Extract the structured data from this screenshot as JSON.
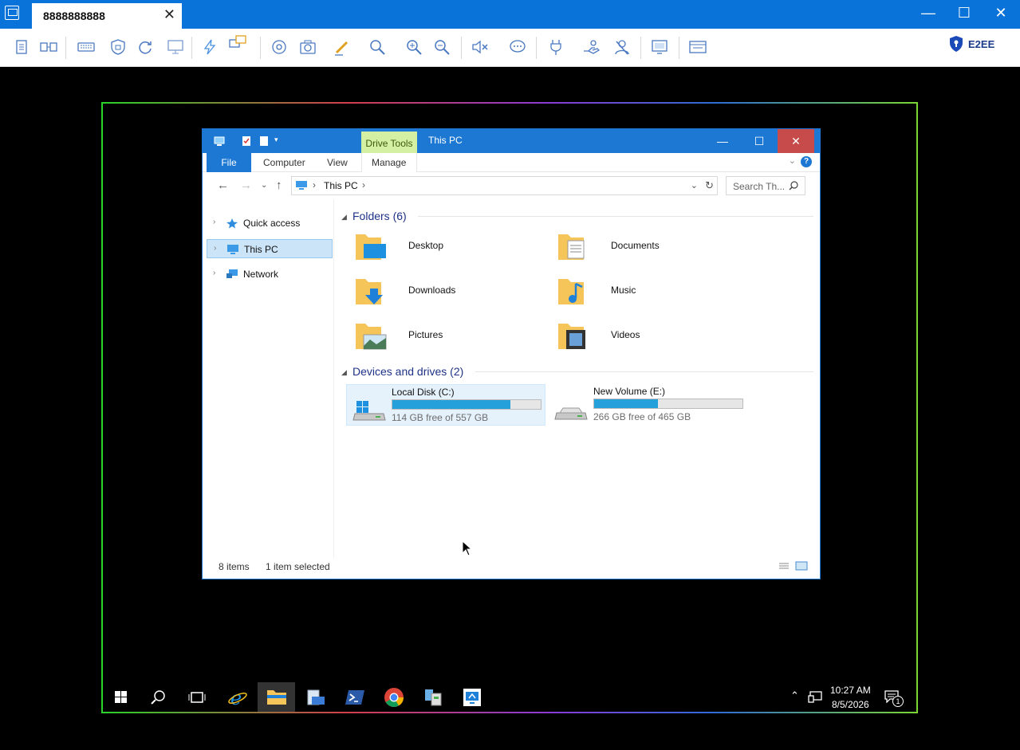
{
  "client": {
    "tab_title": "8888888888",
    "security_label": "E2EE"
  },
  "explorer": {
    "contextual_tab": "Drive Tools",
    "window_title": "This PC",
    "ribbon_tabs": [
      "File",
      "Computer",
      "View",
      "Manage"
    ],
    "address_path": "This PC",
    "search_placeholder": "Search Th...",
    "nav_items": [
      {
        "label": "Quick access",
        "icon": "star-icon",
        "selected": false
      },
      {
        "label": "This PC",
        "icon": "computer-icon",
        "selected": true
      },
      {
        "label": "Network",
        "icon": "network-icon",
        "selected": false
      }
    ],
    "folders_heading": "Folders (6)",
    "folders": [
      {
        "label": "Desktop",
        "icon": "desktop-folder-icon"
      },
      {
        "label": "Documents",
        "icon": "documents-folder-icon"
      },
      {
        "label": "Downloads",
        "icon": "downloads-folder-icon"
      },
      {
        "label": "Music",
        "icon": "music-folder-icon"
      },
      {
        "label": "Pictures",
        "icon": "pictures-folder-icon"
      },
      {
        "label": "Videos",
        "icon": "videos-folder-icon"
      }
    ],
    "drives_heading": "Devices and drives (2)",
    "drives": [
      {
        "name": "Local Disk (C:)",
        "free_text": "114 GB free of 557 GB",
        "used_fraction": 0.795,
        "selected": true
      },
      {
        "name": "New Volume (E:)",
        "free_text": "266 GB free of 465 GB",
        "used_fraction": 0.428,
        "selected": false
      }
    ],
    "status_items": "8 items",
    "status_selected": "1 item selected"
  },
  "taskbar": {
    "time": "10:27 AM",
    "date": "8/5/2026",
    "notification_count": "1"
  },
  "colors": {
    "client_accent": "#0a73d9",
    "explorer_accent": "#1c78d3",
    "drive_bar": "#26a0da",
    "drive_tools_bg": "#d4f0a2"
  }
}
